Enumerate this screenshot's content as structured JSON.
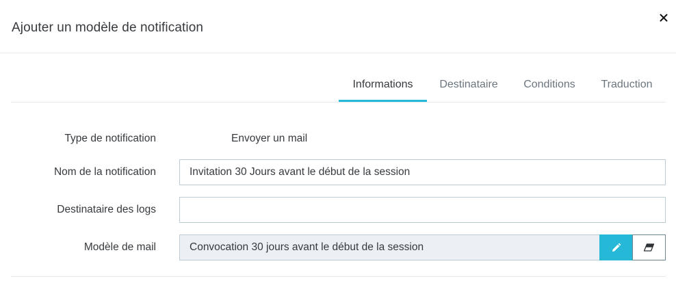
{
  "modal": {
    "title": "Ajouter un modèle de notification",
    "close_symbol": "×"
  },
  "tabs": [
    {
      "label": "Informations",
      "active": true
    },
    {
      "label": "Destinataire",
      "active": false
    },
    {
      "label": "Conditions",
      "active": false
    },
    {
      "label": "Traduction",
      "active": false
    }
  ],
  "form": {
    "notification_type": {
      "label": "Type de notification",
      "value": "Envoyer un mail"
    },
    "notification_name": {
      "label": "Nom de la notification",
      "value": "Invitation 30 Jours avant le début de la session"
    },
    "logs_recipient": {
      "label": "Destinataire des logs",
      "value": ""
    },
    "mail_template": {
      "label": "Modèle de mail",
      "value": "Convocation 30 jours avant le début de la session",
      "edit_icon": "pencil-icon",
      "clear_icon": "eraser-icon"
    }
  },
  "colors": {
    "accent": "#25b9d7",
    "input_border": "#bbcdd2",
    "readonly_bg": "#eceff3"
  }
}
